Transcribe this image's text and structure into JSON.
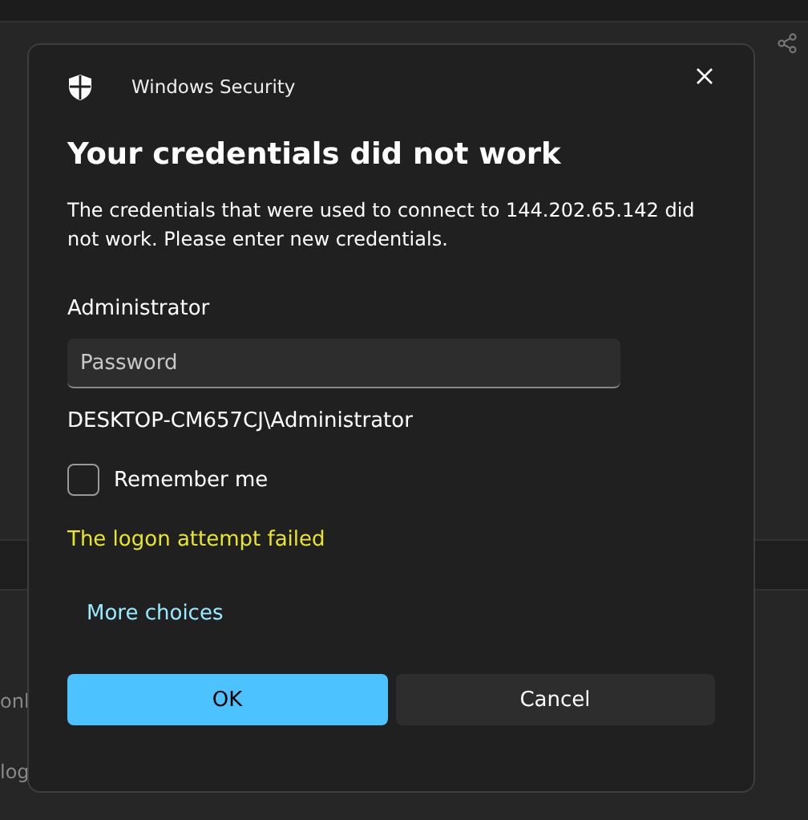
{
  "background": {
    "texts": [
      "onl",
      "log"
    ]
  },
  "dialog": {
    "app_name": "Windows Security",
    "heading": "Your credentials did not work",
    "message": "The credentials that were used to connect to 144.202.65.142 did not work. Please enter new credentials.",
    "username": "Administrator",
    "password": {
      "placeholder": "Password"
    },
    "domain_user": "DESKTOP-CM657CJ\\Administrator",
    "remember": {
      "label": "Remember me",
      "checked": false
    },
    "error": "The logon attempt failed",
    "more_choices": "More choices",
    "buttons": [
      {
        "label": "OK",
        "kind": "primary"
      },
      {
        "label": "Cancel",
        "kind": "secondary"
      }
    ]
  }
}
